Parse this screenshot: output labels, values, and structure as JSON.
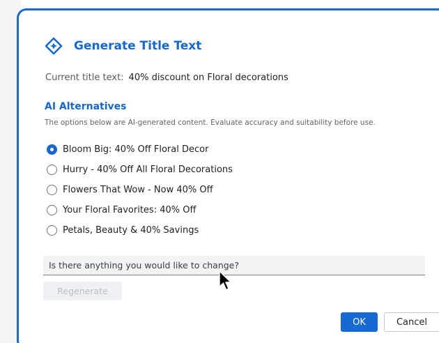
{
  "dialog": {
    "title": "Generate Title Text",
    "title_icon": "ai-sparkle-icon",
    "accent_color": "#1567d3"
  },
  "current": {
    "label": "Current title text:",
    "value": "40% discount on Floral decorations"
  },
  "ai": {
    "heading": "AI Alternatives",
    "note": "The options below are AI-generated content. Evaluate accuracy and suitability before use."
  },
  "options": [
    {
      "label": "Bloom Big: 40% Off Floral Decor",
      "selected": true
    },
    {
      "label": "Hurry - 40% Off All Floral Decorations",
      "selected": false
    },
    {
      "label": "Flowers That Wow - Now 40% Off",
      "selected": false
    },
    {
      "label": "Your Floral Favorites: 40% Off",
      "selected": false
    },
    {
      "label": "Petals, Beauty & 40% Savings",
      "selected": false
    }
  ],
  "change": {
    "placeholder": "Is there anything you would like to change?",
    "value": ""
  },
  "buttons": {
    "regenerate": "Regenerate",
    "ok": "OK",
    "cancel": "Cancel"
  }
}
